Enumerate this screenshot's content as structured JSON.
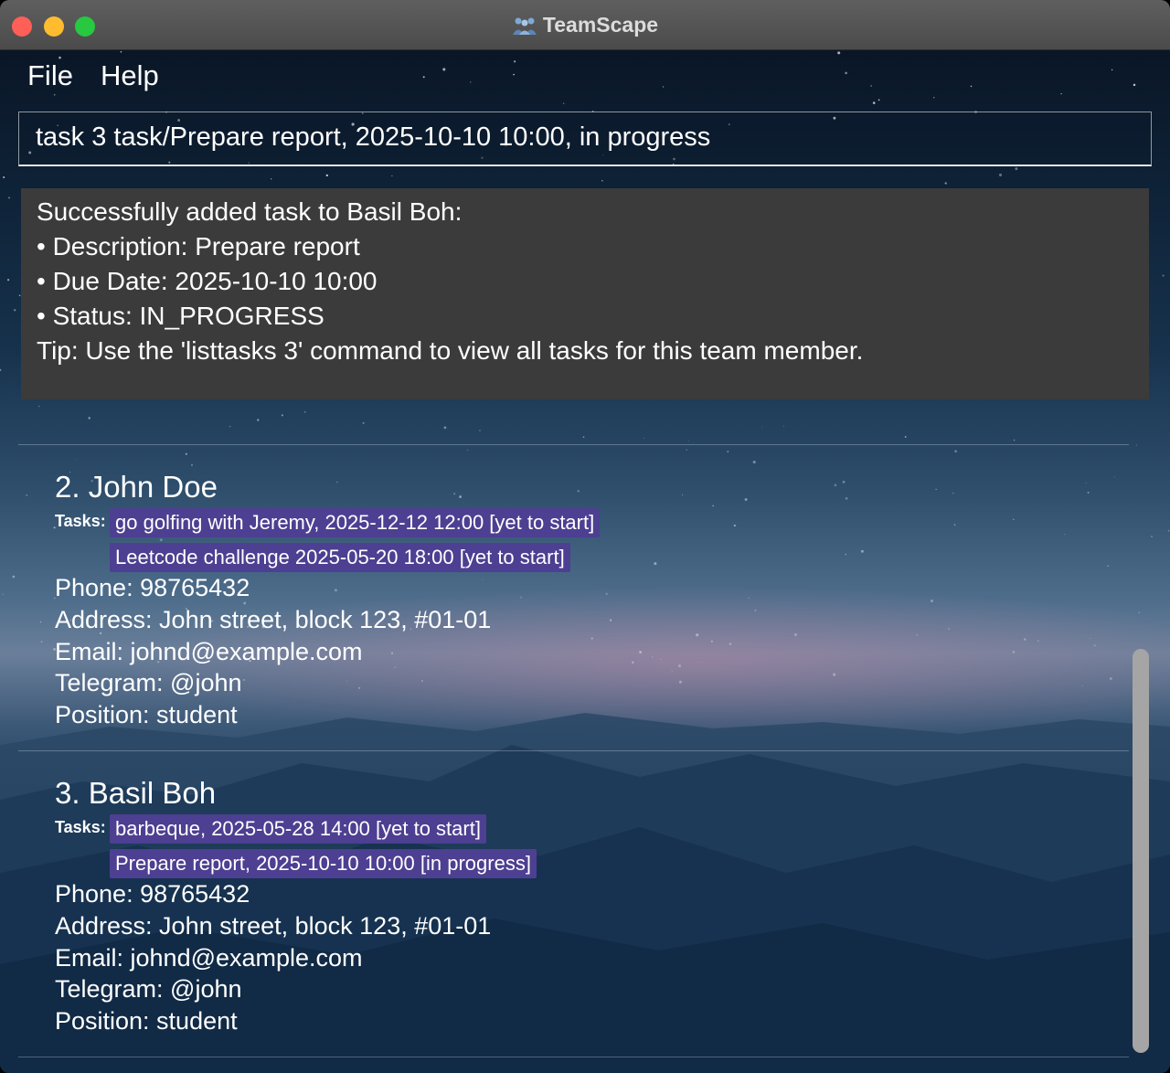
{
  "window": {
    "title": "TeamScape"
  },
  "menu": {
    "file": "File",
    "help": "Help"
  },
  "command": {
    "value": "task 3 task/Prepare report, 2025-10-10 10:00, in progress"
  },
  "result": {
    "lines": [
      "Successfully added task to Basil Boh:",
      "• Description: Prepare report",
      "• Due Date: 2025-10-10 10:00",
      "• Status: IN_PROGRESS",
      "Tip: Use the 'listtasks 3' command to view all tasks for this team member."
    ]
  },
  "persons": [
    {
      "name": "2. John Doe",
      "tasks_label": "Tasks:",
      "tasks": [
        "go golfing with Jeremy, 2025-12-12 12:00 [yet to start]",
        "Leetcode challenge 2025-05-20 18:00 [yet to start]"
      ],
      "phone": "Phone: 98765432",
      "address": "Address: John street, block 123, #01-01",
      "email": "Email: johnd@example.com",
      "telegram": "Telegram: @john",
      "position": "Position: student"
    },
    {
      "name": "3. Basil Boh",
      "tasks_label": "Tasks:",
      "tasks": [
        "barbeque, 2025-05-28 14:00 [yet to start]",
        "Prepare report, 2025-10-10 10:00 [in progress]"
      ],
      "phone": "Phone: 98765432",
      "address": "Address: John street, block 123, #01-01",
      "email": "Email: johnd@example.com",
      "telegram": "Telegram: @john",
      "position": "Position: student"
    }
  ],
  "colors": {
    "task_chip": "#4d3f91",
    "result_bg": "#3b3b3b",
    "close": "#fe5f57",
    "minimize": "#febc2e",
    "maximize": "#28c840"
  },
  "icons": [
    "team-icon",
    "close-icon",
    "minimize-icon",
    "maximize-icon"
  ]
}
